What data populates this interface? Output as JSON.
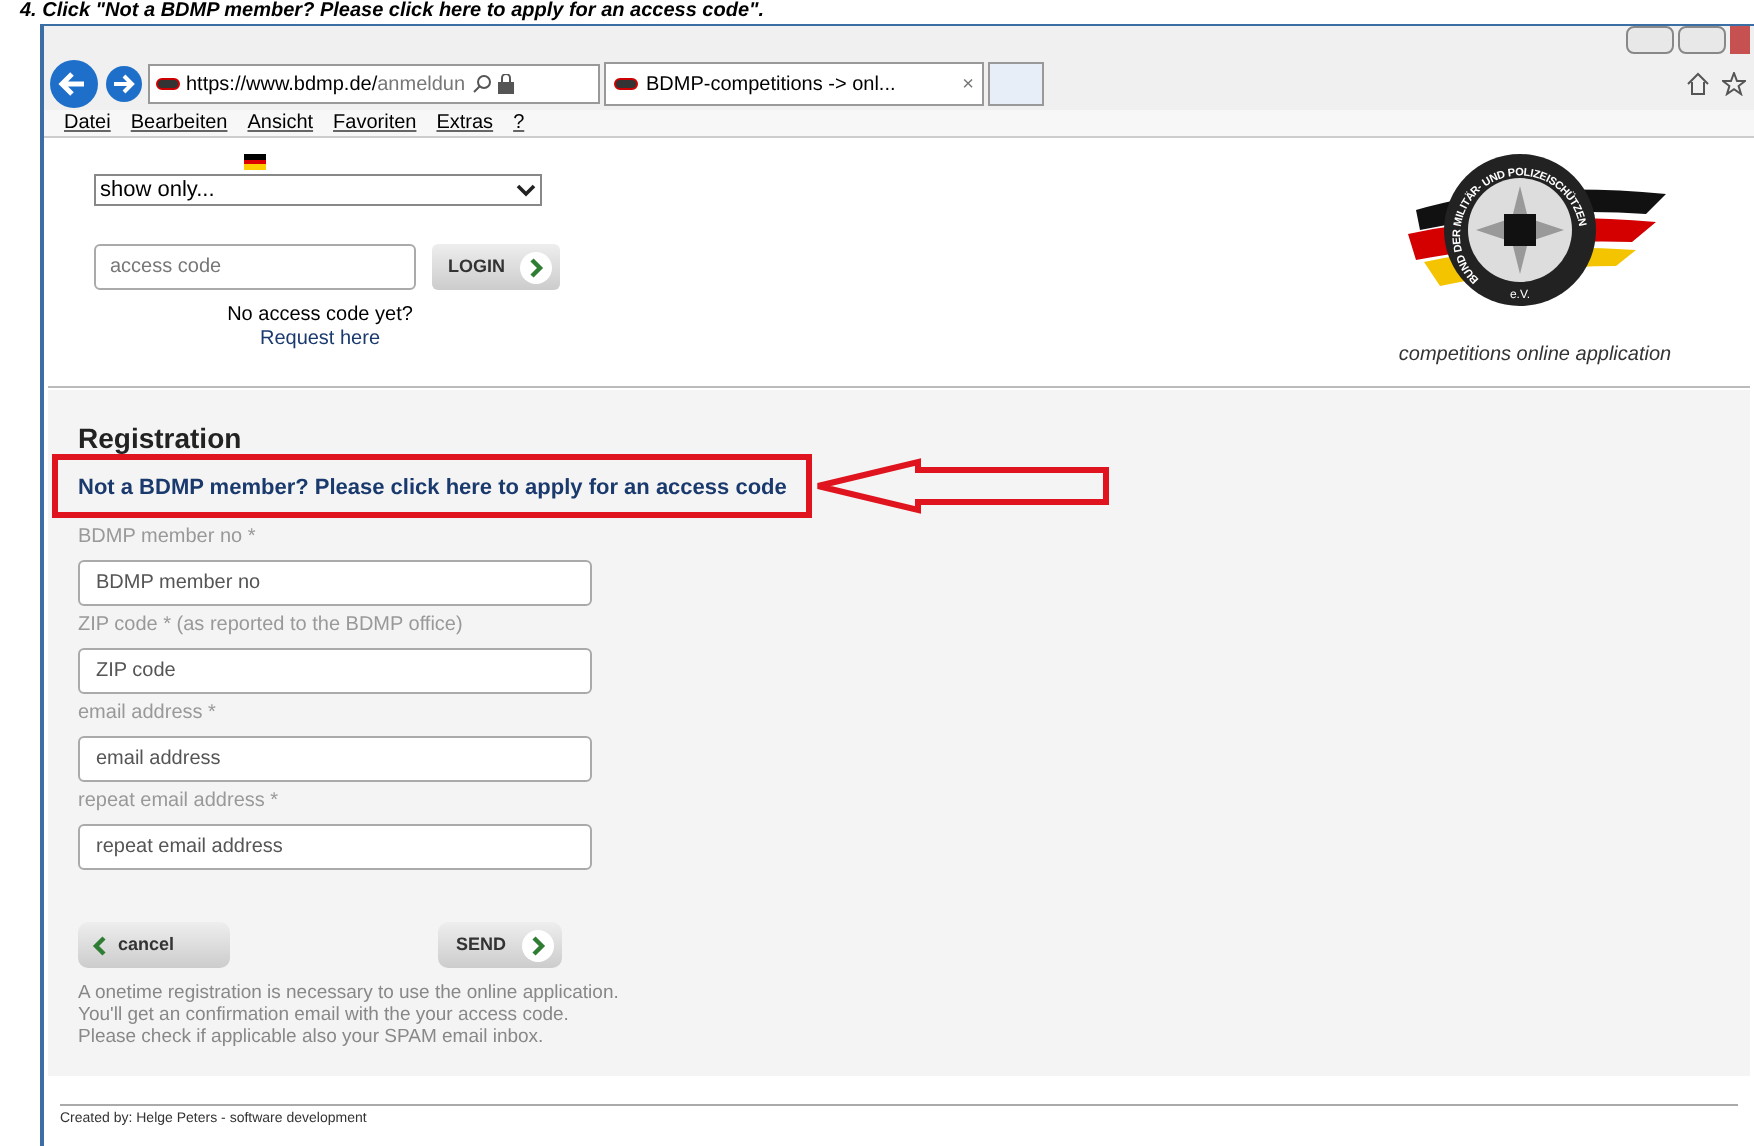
{
  "caption": "4. Click \"Not a BDMP member? Please click here to apply for an access code\".",
  "browser": {
    "url_host": "https://www.bdmp.de/",
    "url_path": "anmeldun",
    "tab_title": "BDMP-competitions -> onl...",
    "tab_close": "×",
    "menu": [
      "Datei",
      "Bearbeiten",
      "Ansicht",
      "Favoriten",
      "Extras",
      "?"
    ]
  },
  "header": {
    "select": {
      "value": "show only..."
    },
    "access_code": {
      "placeholder": "access code"
    },
    "login_button": "LOGIN",
    "no_code": "No access code yet?",
    "request_link": "Request here",
    "emblem_text": "BUND DER MILITÄR- UND POLIZEISCHÜTZEN",
    "emblem_ev": "e.V.",
    "tagline": "competitions online application"
  },
  "registration": {
    "title": "Registration",
    "apply_link": "Not a BDMP member? Please click here to apply for an access code",
    "fields": [
      {
        "label": "BDMP member no *",
        "placeholder": "BDMP member no"
      },
      {
        "label": "ZIP code * (as reported to the BDMP office)",
        "placeholder": "ZIP code"
      },
      {
        "label": "email address *",
        "placeholder": "email address"
      },
      {
        "label": "repeat email address *",
        "placeholder": "repeat email address"
      }
    ],
    "cancel_button": "cancel",
    "send_button": "SEND",
    "notes": [
      "A onetime registration is necessary to use the online application.",
      "You'll get an confirmation email with the your access code.",
      "Please check if applicable also your SPAM email inbox."
    ]
  },
  "footer": "Created by: Helge Peters - software development"
}
